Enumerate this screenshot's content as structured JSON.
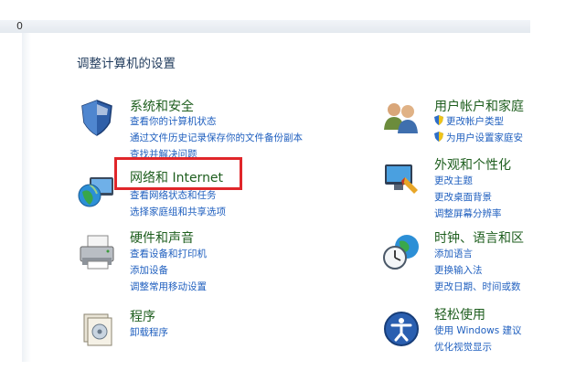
{
  "topbar": {
    "text": "0"
  },
  "page_title": "调整计算机的设置",
  "left_categories": [
    {
      "icon": "shield-icon",
      "title": "系统和安全",
      "links": [
        "查看你的计算机状态",
        "通过文件历史记录保存你的文件备份副本",
        "查找并解决问题"
      ]
    },
    {
      "icon": "network-globe-icon",
      "title": "网络和 Internet",
      "links": [
        "查看网络状态和任务",
        "选择家庭组和共享选项"
      ]
    },
    {
      "icon": "printer-icon",
      "title": "硬件和声音",
      "links": [
        "查看设备和打印机",
        "添加设备",
        "调整常用移动设置"
      ]
    },
    {
      "icon": "programs-icon",
      "title": "程序",
      "links": [
        "卸载程序"
      ]
    }
  ],
  "right_categories": [
    {
      "icon": "users-icon",
      "title": "用户帐户和家庭",
      "links": [
        "更改帐户类型",
        "为用户设置家庭安"
      ]
    },
    {
      "icon": "appearance-icon",
      "title": "外观和个性化",
      "links": [
        "更改主题",
        "更改桌面背景",
        "调整屏幕分辨率"
      ]
    },
    {
      "icon": "clock-globe-icon",
      "title": "时钟、语言和区",
      "links": [
        "添加语言",
        "更换输入法",
        "更改日期、时间或数"
      ]
    },
    {
      "icon": "ease-of-access-icon",
      "title": "轻松使用",
      "links": [
        "使用 Windows 建议",
        "优化视觉显示"
      ]
    }
  ],
  "colors": {
    "title_green": "#1e5e1e",
    "link_blue": "#1f5fbf",
    "highlight_red": "#e0262a"
  }
}
